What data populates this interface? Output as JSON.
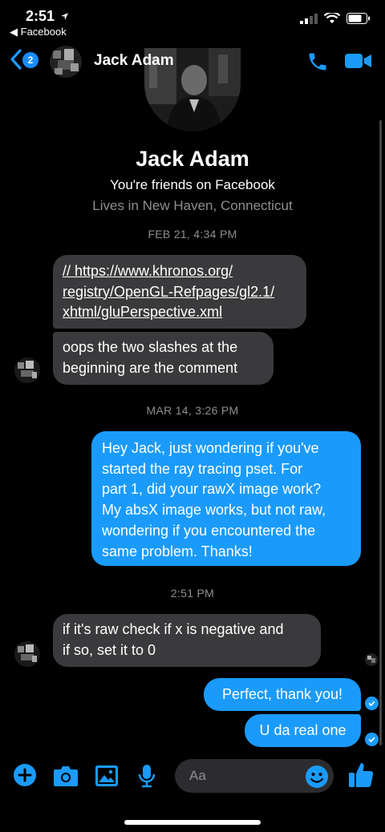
{
  "status_bar": {
    "time": "2:51",
    "back_app": "Facebook"
  },
  "header": {
    "back_badge": "2",
    "contact_name": "Jack Adam"
  },
  "profile": {
    "name": "Jack Adam",
    "friends_text": "You're friends on Facebook",
    "location_text": "Lives in New Haven, Connecticut"
  },
  "timestamps": [
    "FEB 21, 4:34 PM",
    "MAR 14, 3:26 PM",
    "2:51 PM"
  ],
  "messages": [
    {
      "from": "them",
      "lines": [
        "// https://www.khronos.org/",
        "registry/OpenGL-Refpages/gl2.1/",
        "xhtml/gluPerspective.xml"
      ]
    },
    {
      "from": "them",
      "lines": [
        "oops the two slashes at the",
        "beginning are the comment"
      ]
    },
    {
      "from": "me",
      "lines": [
        "Hey Jack, just wondering if you've",
        "started the ray tracing pset. For",
        "part 1, did your rawX image work?",
        "My absX image works, but not raw,",
        "wondering if you encountered the",
        "same problem. Thanks!"
      ]
    },
    {
      "from": "them",
      "lines": [
        "if it's raw check if x is negative and",
        "if so, set it to 0"
      ]
    },
    {
      "from": "me",
      "lines": [
        "Perfect, thank you!"
      ]
    },
    {
      "from": "me",
      "lines": [
        "U da real one"
      ]
    }
  ],
  "composer": {
    "placeholder": "Aa"
  },
  "icons": {
    "back": "chevron-left-icon",
    "call": "phone-icon",
    "video": "video-camera-icon",
    "add": "plus-icon",
    "camera": "camera-icon",
    "gallery": "image-icon",
    "mic": "microphone-icon",
    "emoji": "emoji-icon",
    "like": "thumbs-up-icon"
  },
  "colors": {
    "accent": "#1a9bfc",
    "incoming_bubble": "#3a3a3c",
    "background": "#000000"
  }
}
